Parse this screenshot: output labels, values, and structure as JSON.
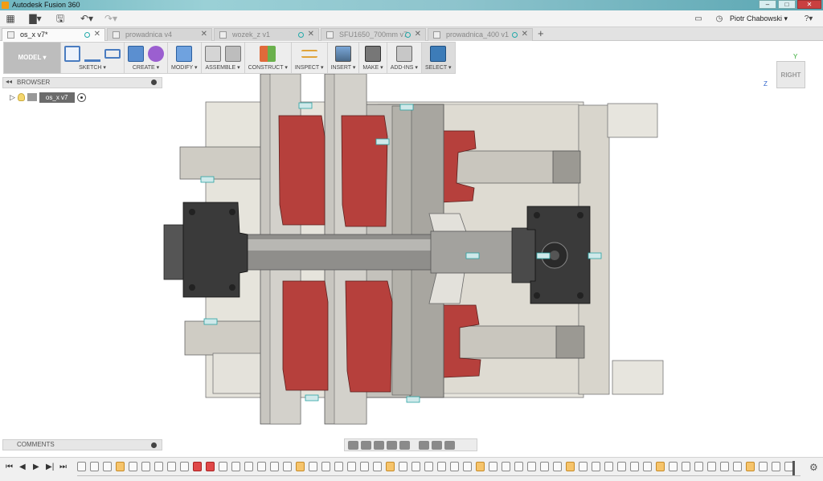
{
  "app": {
    "title": "Autodesk Fusion 360"
  },
  "window_controls": {
    "minimize": "‒",
    "maximize": "□",
    "close": "✕"
  },
  "qab": {
    "grid": "▦",
    "file": "▇▾",
    "save": "🖫",
    "undo": "↶▾",
    "redo": "↷▾",
    "user": "Piotr Chabowski ▾",
    "help": "?▾"
  },
  "tabs": [
    {
      "label": "os_x v7*",
      "active": true
    },
    {
      "label": "prowadnica v4",
      "active": false
    },
    {
      "label": "wozek_z v1",
      "active": false
    },
    {
      "label": "SFU1650_700mm v7",
      "active": false
    },
    {
      "label": "prowadnica_400 v1",
      "active": false
    }
  ],
  "tab_close": "✕",
  "tab_add": "+",
  "toolbar": {
    "mode": "MODEL ▾",
    "groups": [
      {
        "label": "SKETCH ▾"
      },
      {
        "label": "CREATE ▾"
      },
      {
        "label": "MODIFY ▾"
      },
      {
        "label": "ASSEMBLE ▾"
      },
      {
        "label": "CONSTRUCT ▾"
      },
      {
        "label": "INSPECT ▾"
      },
      {
        "label": "INSERT ▾"
      },
      {
        "label": "MAKE ▾"
      },
      {
        "label": "ADD-INS ▾"
      },
      {
        "label": "SELECT ▾"
      }
    ]
  },
  "browser": {
    "title": "BROWSER",
    "collapse": "◂◂",
    "root_node": "os_x v7",
    "expander": "▷"
  },
  "comments": {
    "title": "COMMENTS"
  },
  "viewcube": {
    "face": "RIGHT",
    "axis_y": "Y",
    "axis_z": "Z"
  },
  "timeline": {
    "first": "⏮",
    "prev": "◀",
    "play": "▶",
    "next": "▶|",
    "last": "⏭",
    "settings": "⚙"
  },
  "colors": {
    "part_gray": "#d9d6cd",
    "block_red": "#b6403c",
    "dark_part": "#3a3a3a",
    "shaft": "#9a9a9a",
    "accent_teal": "#2aa3a3"
  }
}
